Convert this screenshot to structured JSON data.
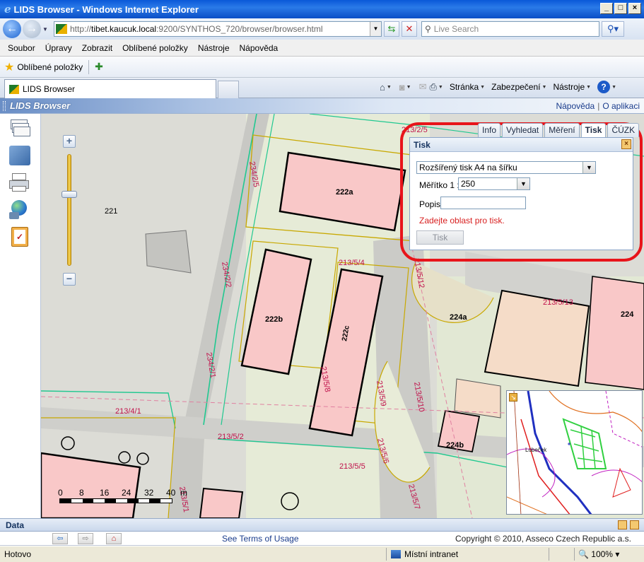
{
  "browser": {
    "title": "LIDS Browser - Windows Internet Explorer",
    "url_proto": "http://",
    "url_host": "tibet.kaucuk.local",
    "url_rest": ":9200/SYNTHOS_720/browser/browser.html",
    "search_placeholder": "Live Search",
    "menu": [
      "Soubor",
      "Úpravy",
      "Zobrazit",
      "Oblíbené položky",
      "Nástroje",
      "Nápověda"
    ],
    "favorites_label": "Oblíbené položky",
    "tab_label": "LIDS Browser",
    "cmd": {
      "page": "Stránka",
      "security": "Zabezpečení",
      "tools": "Nástroje"
    },
    "status": "Hotovo",
    "zone": "Místní intranet",
    "zoom": "100%"
  },
  "app": {
    "title": "LIDS Browser",
    "help_link": "Nápověda",
    "about_link": "O aplikaci",
    "data_label": "Data",
    "terms": "See Terms of Usage",
    "copyright": "Copyright © 2010, Asseco Czech Republic a.s."
  },
  "panel": {
    "tabs": [
      "Info",
      "Vyhledat",
      "Měření",
      "Tisk",
      "ČÚZK"
    ],
    "active_tab": "Tisk",
    "title": "Tisk",
    "template_value": "Rozšířený tisk A4 na šířku",
    "scale_label": "Měřítko 1 :",
    "scale_value": "250",
    "desc_label": "Popis",
    "desc_value": "",
    "error": "Zadejte oblast pro tisk.",
    "print_button": "Tisk"
  },
  "map": {
    "parcels": [
      "221",
      "222a",
      "222b",
      "222c",
      "224a",
      "224b",
      "224",
      "213/5/13",
      "213/5/4",
      "213/5/2",
      "213/5/5",
      "213/5/7",
      "213/5/1",
      "213/4/1",
      "213/5/10",
      "213/5/12",
      "234/2/5",
      "234/2/2",
      "234/2/1",
      "213/5/8",
      "213/5/9",
      "213/5/6",
      "213/2/5"
    ],
    "scale_ticks": [
      "0",
      "8",
      "16",
      "24",
      "32",
      "40"
    ],
    "scale_unit": "m",
    "overview_label": "Lobeček"
  },
  "colors": {
    "highlight": "#e8141a",
    "building": "#f9c8c8",
    "boundary_green": "#20c890",
    "lot_line": "#c8a800",
    "parcel_text": "#c0104a"
  }
}
